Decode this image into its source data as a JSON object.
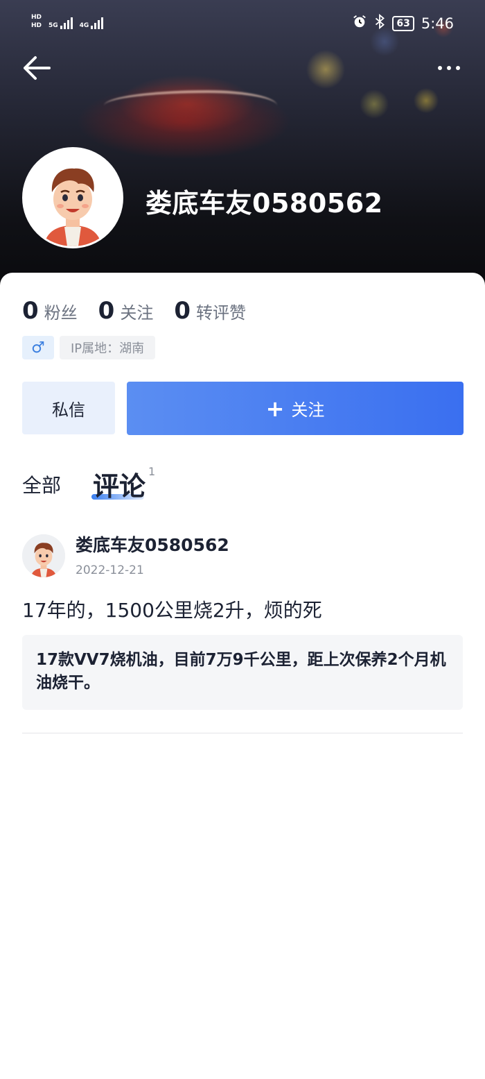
{
  "status_bar": {
    "left_tags": [
      "HD",
      "HD"
    ],
    "network_1": "5G",
    "network_2": "4G",
    "battery": "63",
    "time": "5:46",
    "icons": [
      "alarm-icon",
      "bluetooth-icon"
    ]
  },
  "profile": {
    "username": "娄底车友0580562",
    "stats": [
      {
        "num": "0",
        "label": "粉丝"
      },
      {
        "num": "0",
        "label": "关注"
      },
      {
        "num": "0",
        "label": "转评赞"
      }
    ],
    "gender_symbol": "♂",
    "ip_location": "IP属地：湖南"
  },
  "actions": {
    "message_label": "私信",
    "follow_plus": "+",
    "follow_label": "关注"
  },
  "tabs": {
    "all": "全部",
    "comments": "评论",
    "comments_count": "1"
  },
  "comment": {
    "author": "娄底车友0580562",
    "date": "2022-12-21",
    "text": "17年的，1500公里烧2升，烦的死",
    "quote": "17款VV7烧机油，目前7万9千公里，距上次保养2个月机油烧干。"
  },
  "colors": {
    "accent": "#3a6ff0",
    "text_primary": "#1c2233",
    "text_secondary": "#8a8f99"
  }
}
